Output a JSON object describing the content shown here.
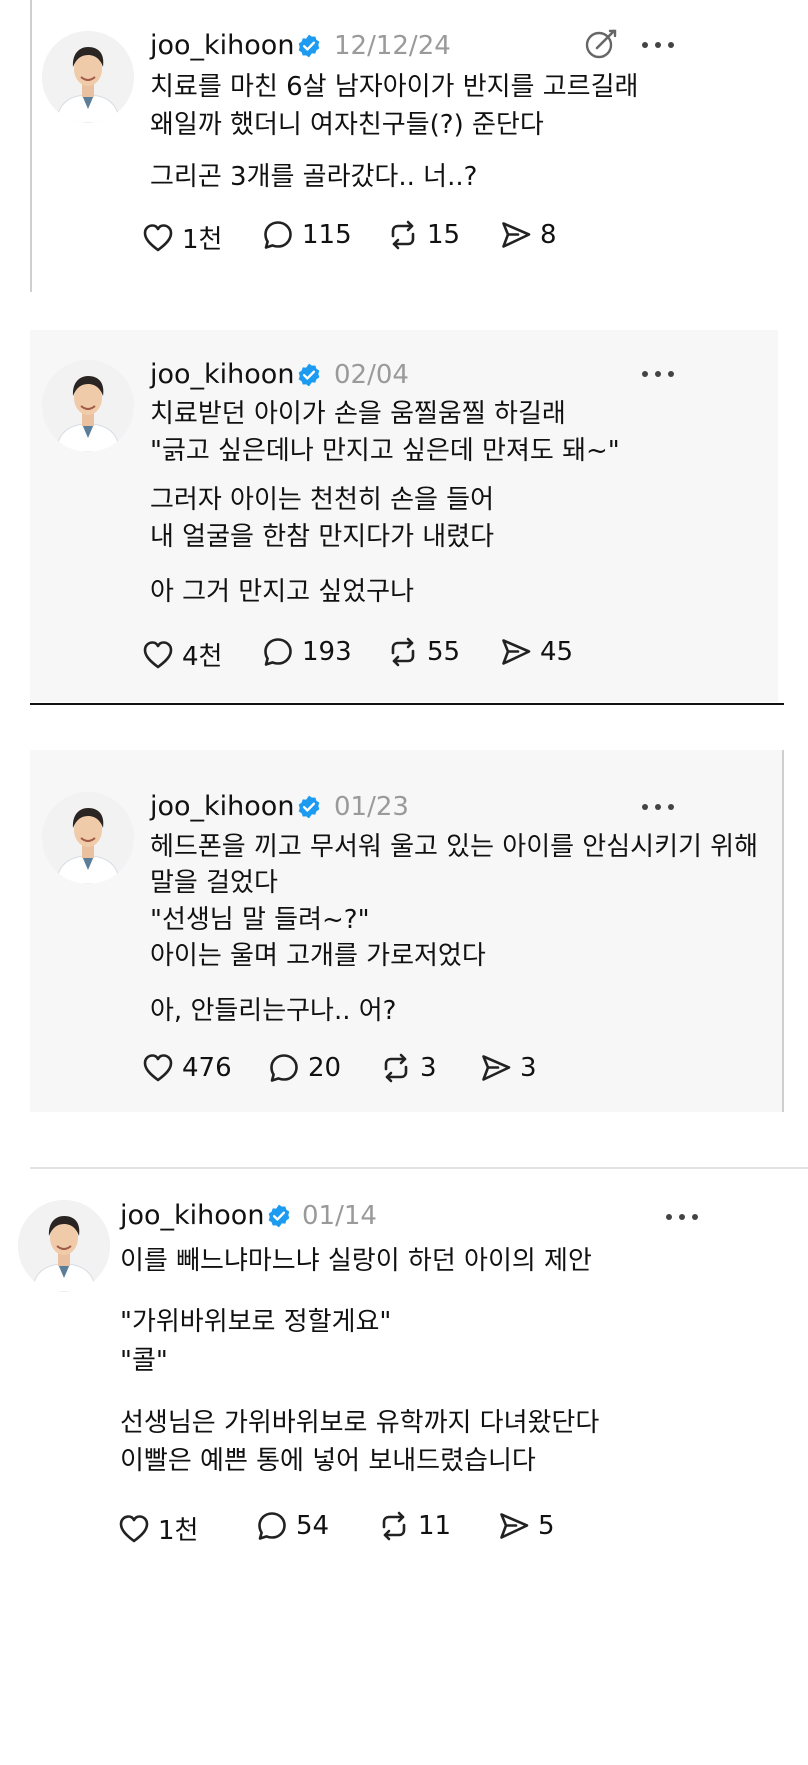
{
  "posts": [
    {
      "username": "joo_kihoon",
      "date": "12/12/24",
      "paragraphs": [
        [
          "치료를 마친 6살 남자아이가 반지를 고르길래",
          "왜일까 했더니 여자친구들(?) 준단다"
        ],
        [
          "그리곤 3개를 골라갔다.. 너..?"
        ]
      ],
      "likes": "1천",
      "replies": "115",
      "reposts": "15",
      "shares": "8"
    },
    {
      "username": "joo_kihoon",
      "date": "02/04",
      "paragraphs": [
        [
          "치료받던 아이가 손을 움찔움찔 하길래",
          "\"긁고 싶은데나 만지고 싶은데 만져도 돼~\""
        ],
        [
          "그러자 아이는 천천히 손을 들어",
          "내 얼굴을 한참 만지다가 내렸다"
        ],
        [
          "아 그거 만지고 싶었구나"
        ]
      ],
      "likes": "4천",
      "replies": "193",
      "reposts": "55",
      "shares": "45"
    },
    {
      "username": "joo_kihoon",
      "date": "01/23",
      "paragraphs": [
        [
          "헤드폰을 끼고 무서워 울고 있는 아이를 안심시키기 위해",
          "말을 걸었다",
          "\"선생님 말 들려~?\"",
          "아이는 울며 고개를 가로저었다"
        ],
        [
          "아, 안들리는구나.. 어?"
        ]
      ],
      "likes": "476",
      "replies": "20",
      "reposts": "3",
      "shares": "3"
    },
    {
      "username": "joo_kihoon",
      "date": "01/14",
      "paragraphs": [
        [
          "이를 빼느냐마느냐 실랑이 하던 아이의 제안"
        ],
        [
          "\"가위바위보로 정할게요\"",
          "\"콜\""
        ],
        [
          "선생님은 가위바위보로 유학까지 다녀왔단다",
          "이빨은 예쁜 통에 넣어 보내드렸습니다"
        ]
      ],
      "likes": "1천",
      "replies": "54",
      "reposts": "11",
      "shares": "5"
    }
  ],
  "icons": {
    "verified": "verified-badge-icon",
    "more": "more-options-icon",
    "edit": "edit-icon",
    "like": "heart-icon",
    "reply": "speech-bubble-icon",
    "repost": "repost-icon",
    "share": "send-icon"
  },
  "colors": {
    "verified": "#1d9bf0",
    "muted": "#9a9a9a",
    "text": "#111111"
  }
}
